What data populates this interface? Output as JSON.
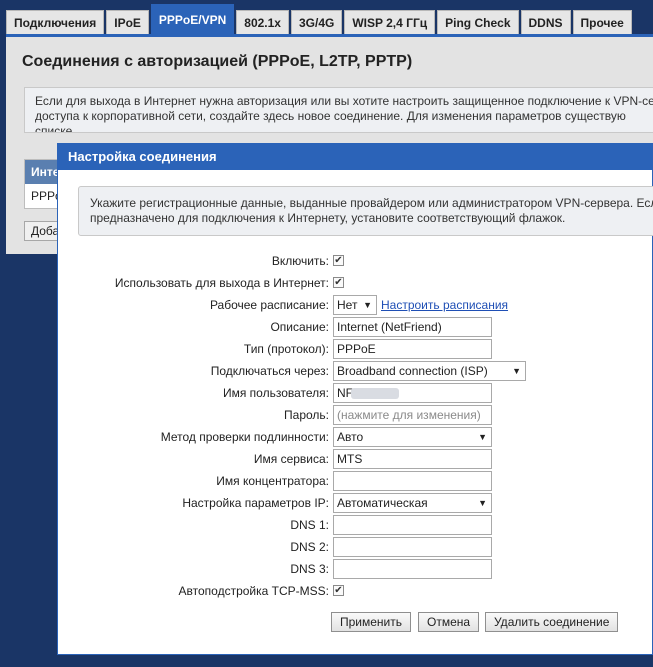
{
  "tabs": [
    {
      "label": "Подключения"
    },
    {
      "label": "IPoE"
    },
    {
      "label": "PPPoE/VPN"
    },
    {
      "label": "802.1x"
    },
    {
      "label": "3G/4G"
    },
    {
      "label": "WISP 2,4 ГГц"
    },
    {
      "label": "Ping Check"
    },
    {
      "label": "DDNS"
    },
    {
      "label": "Прочее"
    }
  ],
  "page": {
    "title": "Соединения с авторизацией (PPPoE, L2TP, PPTP)",
    "info_line1": "Если для выхода в Интернет нужна авторизация или вы хотите настроить защищенное подключение к VPN-се",
    "info_line2": "доступа к корпоративной сети, создайте здесь новое соединение. Для изменения параметров существую",
    "info_line3": "списке.",
    "table_header": "Инте",
    "table_cell": "PPPo",
    "add_button": "Доба"
  },
  "modal": {
    "title": "Настройка соединения",
    "info_line1": "Укажите регистрационные данные, выданные провайдером или администратором VPN-сервера. Есл",
    "info_line2": "предназначено для подключения к Интернету, установите соответствующий флажок.",
    "fields": {
      "enable": {
        "label": "Включить:",
        "checked": true
      },
      "internet": {
        "label": "Использовать для выхода в Интернет:",
        "checked": true
      },
      "schedule": {
        "label": "Рабочее расписание:",
        "value": "Нет",
        "link": "Настроить расписания"
      },
      "description": {
        "label": "Описание:",
        "value": "Internet (NetFriend)"
      },
      "protocol": {
        "label": "Тип (протокол):",
        "value": "PPPoE"
      },
      "via": {
        "label": "Подключаться через:",
        "value": "Broadband connection (ISP)"
      },
      "username": {
        "label": "Имя пользователя:",
        "value": "NF"
      },
      "password": {
        "label": "Пароль:",
        "placeholder": "(нажмите для изменения)"
      },
      "auth": {
        "label": "Метод проверки подлинности:",
        "value": "Авто"
      },
      "service": {
        "label": "Имя сервиса:",
        "value": "MTS"
      },
      "concentrator": {
        "label": "Имя концентратора:",
        "value": ""
      },
      "ip": {
        "label": "Настройка параметров IP:",
        "value": "Автоматическая"
      },
      "dns1": {
        "label": "DNS 1:",
        "value": ""
      },
      "dns2": {
        "label": "DNS 2:",
        "value": ""
      },
      "dns3": {
        "label": "DNS 3:",
        "value": ""
      },
      "tcpmss": {
        "label": "Автоподстройка TCP-MSS:",
        "checked": true
      }
    },
    "buttons": {
      "apply": "Применить",
      "cancel": "Отмена",
      "delete": "Удалить соединение"
    }
  },
  "glyphs": {
    "check": "✔",
    "arrow": "▼"
  }
}
